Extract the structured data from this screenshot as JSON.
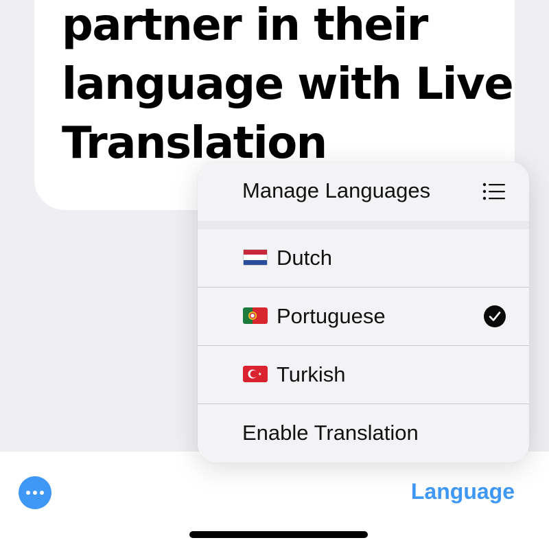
{
  "card": {
    "lines": [
      "partner in their",
      "language with Live",
      "Translation"
    ]
  },
  "menu": {
    "header": {
      "label": "Manage Languages",
      "icon": "list-icon"
    },
    "languages": [
      {
        "label": "Dutch",
        "flag": "netherlands-flag-icon",
        "selected": false
      },
      {
        "label": "Portuguese",
        "flag": "portugal-flag-icon",
        "selected": true
      },
      {
        "label": "Turkish",
        "flag": "turkey-flag-icon",
        "selected": false
      }
    ],
    "enable_label": "Enable Translation",
    "check_icon": "checkmark-circle-icon"
  },
  "toolbar": {
    "more_icon": "ellipsis-circle-icon",
    "language_label": "Language"
  },
  "colors": {
    "accent": "#3f97f6",
    "background": "#eeeef3",
    "card": "#ffffff",
    "menu": "#f3f3f6"
  }
}
